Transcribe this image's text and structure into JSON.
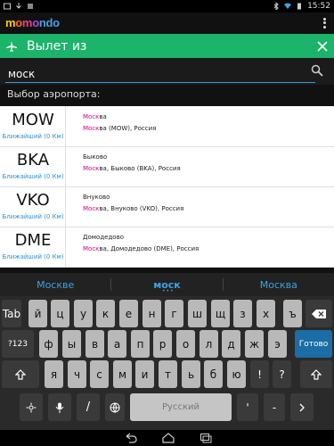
{
  "status_bar": {
    "time": "15:52"
  },
  "header": {
    "logo_parts": [
      "m",
      "o",
      "m",
      "o",
      "ndo"
    ]
  },
  "green_bar": {
    "title": "Вылет из"
  },
  "search": {
    "value": "моск",
    "placeholder": ""
  },
  "section_label": "Выбор аэропорта:",
  "airports": [
    {
      "code": "MOW",
      "nearest": "Ближайший (0 Км)",
      "city_hl": "Моск",
      "city_rest": "ва",
      "detail_hl": "Моск",
      "detail_rest": "ва (MOW), Россия"
    },
    {
      "code": "BKA",
      "nearest": "Ближайший (0 Км)",
      "city_full": "Быково",
      "detail_hl": "Моск",
      "detail_rest": "ва, Быково (BKA), Россия"
    },
    {
      "code": "VKO",
      "nearest": "Ближайший (0 Км)",
      "city_full": "Внуково",
      "detail_hl": "Моск",
      "detail_rest": "ва, Внуково (VKO), Россия"
    },
    {
      "code": "DME",
      "nearest": "Ближайший (0 Км)",
      "city_full": "Домодедово",
      "detail_hl": "Моск",
      "detail_rest": "ва, Домодедово (DME), Россия"
    }
  ],
  "suggestions": [
    "Москве",
    "моск",
    "Москва"
  ],
  "keyboard": {
    "row1": [
      "Tab",
      "й",
      "ц",
      "у",
      "к",
      "е",
      "н",
      "г",
      "ш",
      "щ",
      "з",
      "х",
      "ъ"
    ],
    "row2": [
      "?123",
      "ф",
      "ы",
      "в",
      "а",
      "п",
      "р",
      "о",
      "л",
      "д",
      "ж",
      "э",
      "Готово"
    ],
    "row3": [
      "я",
      "ч",
      "с",
      "м",
      "и",
      "т",
      "ь",
      "б",
      "ю",
      "!",
      "?"
    ],
    "row4_slash": "/",
    "space_label": "Русский",
    "row4_punct": [
      "'",
      "-"
    ],
    "shift_icon": "shift-icon",
    "backspace_icon": "backspace-icon",
    "settings_icon": "settings-icon",
    "mic_icon": "mic-icon",
    "globe_icon": "globe-icon",
    "chevron_icon": "chevron-icon"
  },
  "colors": {
    "accent_green": "#1cb36b",
    "highlight": "#d6008c",
    "link_blue": "#2a8fd6",
    "done_key": "#1b6da5"
  }
}
